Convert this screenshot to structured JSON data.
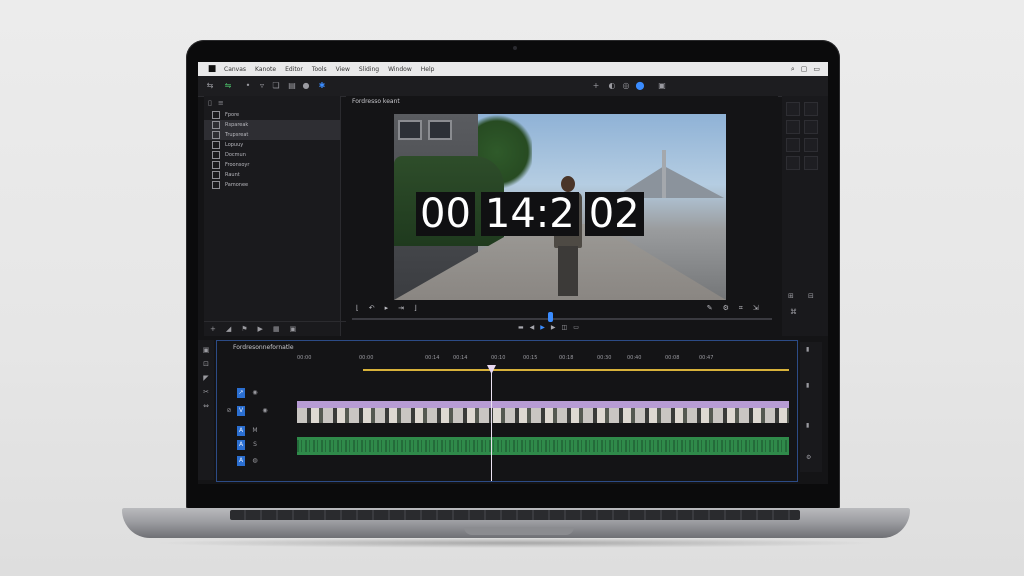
{
  "app": {
    "menu_items": [
      "Canvas",
      "Kanote",
      "Editor",
      "Tools",
      "View",
      "Sliding",
      "Window",
      "Help"
    ],
    "viewer_title": "Fordresso keant",
    "timeline_title": "Fordresonnefornatle"
  },
  "timecode": {
    "hours": "00",
    "minutes": "14:2",
    "frames": "02"
  },
  "project_items": [
    "Fpore",
    "Rspareak",
    "Trupsreat",
    "Lopuuy",
    "Docmun",
    "Froonsoyr",
    "Raunt",
    "Pamonee"
  ],
  "ruler_ticks": [
    "00:00",
    "00:00",
    "00:14",
    "00:14",
    "00:10",
    "00:15",
    "00:18",
    "00:30",
    "00:40",
    "00:08",
    "00:47"
  ],
  "colors": {
    "accent": "#3a8cff",
    "workarea": "#d8b23a",
    "video_clip_label": "#b79cd4",
    "audio_clip": "#2f8a4a",
    "timeline_border": "#2c4b86"
  },
  "icons": {
    "toolbar": [
      "layout-icon",
      "sync-icon",
      "dot-icon",
      "filter-icon",
      "mark-icon",
      "circle-icon",
      "bluetooth-icon"
    ],
    "right_toolbar": [
      "add-icon",
      "color-icon",
      "fx-icon",
      "export-icon"
    ],
    "viewer_controls": [
      "mark-in-icon",
      "step-back-icon",
      "play-icon",
      "step-forward-icon",
      "mark-out-icon"
    ],
    "viewer_right": [
      "pen-icon",
      "settings-icon",
      "fit-icon",
      "export-frame-icon"
    ]
  }
}
